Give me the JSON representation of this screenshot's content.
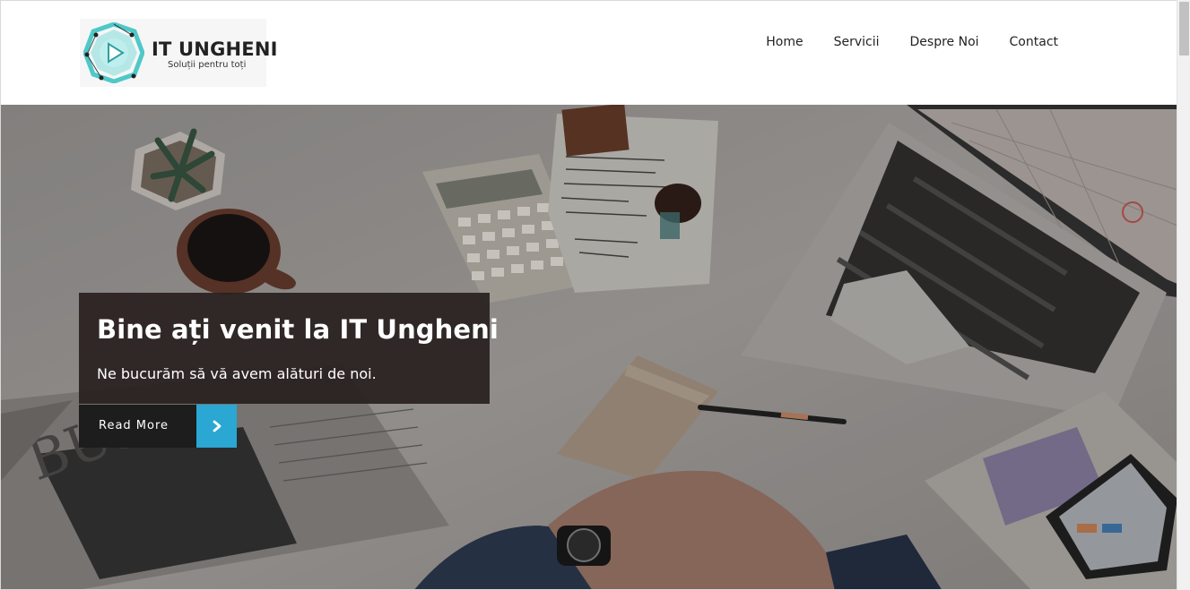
{
  "brand": {
    "title": "IT UNGHENI",
    "tagline": "Soluții pentru toți",
    "accent_color": "#4fc8c8"
  },
  "nav": {
    "items": [
      "Home",
      "Servicii",
      "Despre Noi",
      "Contact"
    ]
  },
  "hero": {
    "title": "Bine ați venit la IT Ungheni",
    "subtitle": "Ne bucurăm să vă avem alături de noi.",
    "button_label": "Read More",
    "button_icon": "chevron-right-icon",
    "button_accent": "#2aa7d3"
  }
}
